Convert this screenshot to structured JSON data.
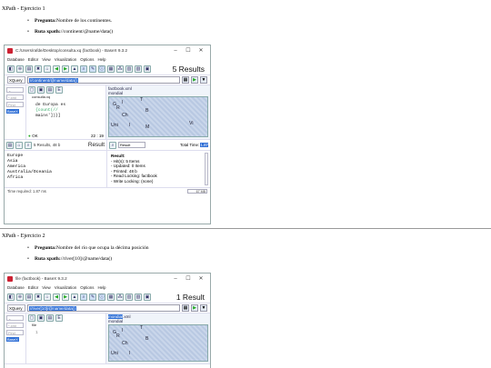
{
  "exercise1": {
    "title": "XPath - Ejercicio 1",
    "pregunta_label": "Pregunta:",
    "pregunta_text": "Nombre de los continentes.",
    "ruta_label": "Ruta xpath:",
    "ruta_text": "//continent/@name/data()",
    "window": {
      "title": "C:/Users/rafde/Desktop/consulta.xq (factbook) - BaseX 9.3.2",
      "menu": [
        "Database",
        "Editor",
        "View",
        "Visualization",
        "Options",
        "Help"
      ],
      "results_count": "5 Results",
      "query_mode": "XQuery",
      "query": "//continent/@name/data()",
      "editor_tab": "consulta.xq",
      "editor_lines": [
        "de Europa es",
        "{count(//",
        "mains'])}]"
      ],
      "editor_status_ok": "OK",
      "editor_status_pos": "22 : 19",
      "map_head_1": "factbook.xml",
      "map_head_2": "mondial",
      "map_labels": [
        "G",
        "I",
        "T",
        "R",
        "B",
        "Ch",
        "Uni",
        "I",
        "M",
        "Vi"
      ],
      "results_header_count": "5 Results, 48 b",
      "results_header_title": "Result",
      "results": [
        "Europe",
        "Asia",
        "America",
        "Australia/Oceania",
        "Africa"
      ],
      "info_select": "Result",
      "info_total": "Total Time:",
      "info_total_val": "1.87",
      "info_title": "Result:",
      "info_lines": [
        "- Hit(s): 5 Items",
        "- Updated: 0 Items",
        "- Printed: 48 b",
        "- Read Locking: factbook",
        "- Write Locking: (none)"
      ],
      "status_left": "Time required: 1.87 ms",
      "status_mem": "67 MB"
    }
  },
  "exercise2": {
    "title": "XPath - Ejercicio 2",
    "pregunta_label": "Pregunta:",
    "pregunta_text": "Nombre del río que ocupa la décima posición",
    "ruta_label": "Ruta xpath:",
    "ruta_text": "//river[10]/@name/data()",
    "window": {
      "title": "file (factbook) - BaseX 9.3.2",
      "menu": [
        "Database",
        "Editor",
        "View",
        "Visualization",
        "Options",
        "Help"
      ],
      "results_count": "1 Result",
      "query_mode": "XQuery",
      "query": "//river[10]/@name/data()",
      "editor_tab": "file",
      "editor_line_no": "1",
      "map_head_1": "mondial",
      "map_head_1b": ".xml",
      "map_head_2": "mondial",
      "map_labels": [
        "G",
        "I",
        "T",
        "R",
        "B",
        "Ch",
        "Uni",
        "I"
      ]
    }
  },
  "icons": {
    "app": "basex-icon",
    "minimize": "–",
    "maximize": "☐",
    "close": "✕",
    "run": "▶",
    "filter": "▼"
  }
}
